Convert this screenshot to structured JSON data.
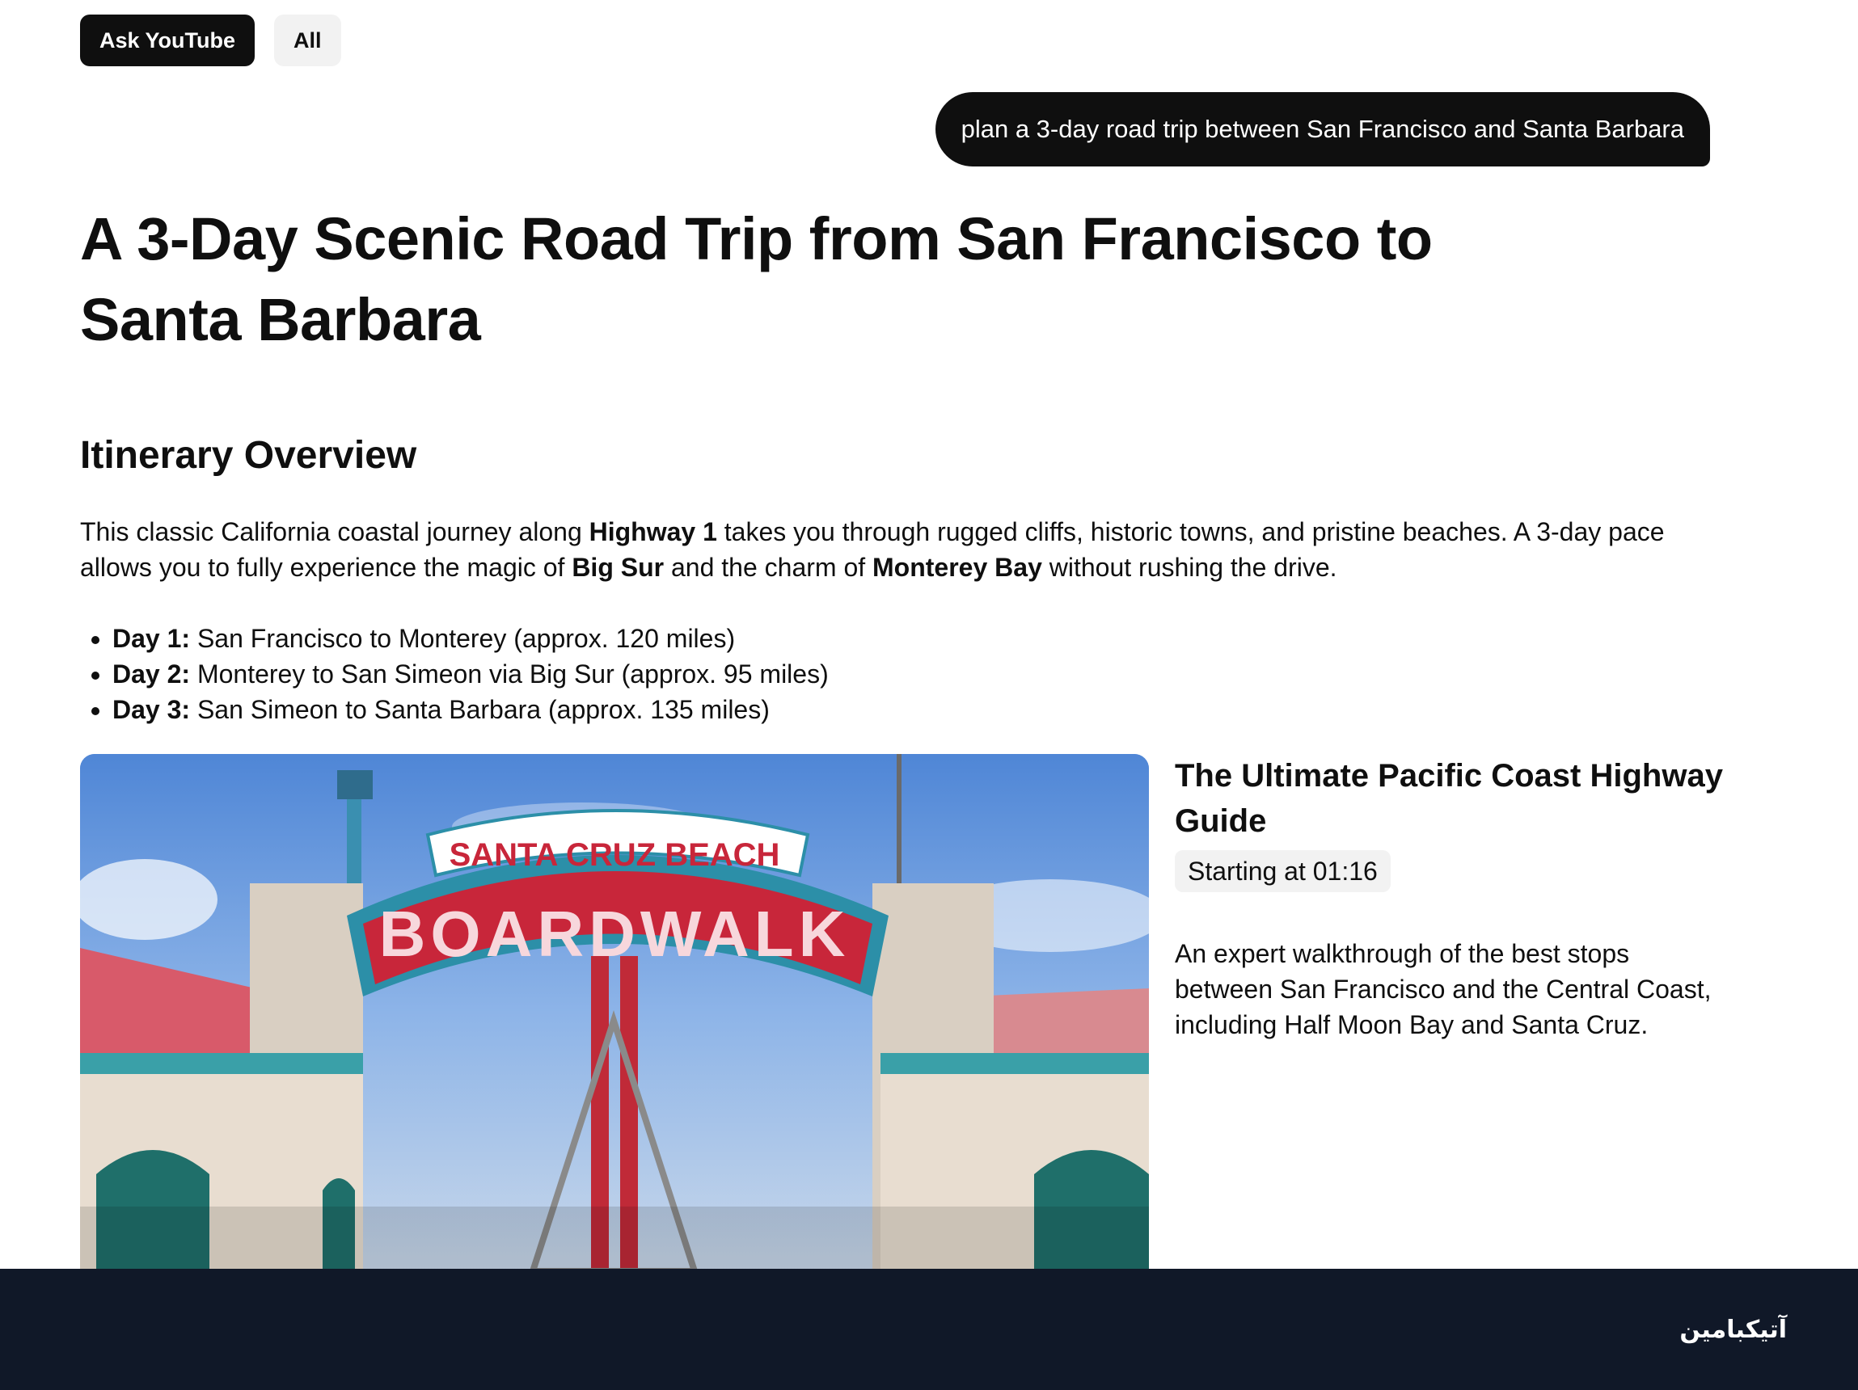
{
  "chips": [
    {
      "label": "Ask YouTube",
      "active": true
    },
    {
      "label": "All",
      "active": false
    }
  ],
  "query": "plan a 3-day road trip between San Francisco and Santa Barbara",
  "article": {
    "title": "A 3-Day Scenic Road Trip from San Francisco to Santa Barbara",
    "section_heading": "Itinerary Overview",
    "intro": {
      "p1": "This classic California coastal journey along ",
      "b1": "Highway 1",
      "p2": " takes you through rugged cliffs, historic towns, and pristine beaches. A 3-day pace allows you to fully experience the magic of ",
      "b2": "Big Sur",
      "p3": " and the charm of ",
      "b3": "Monterey Bay",
      "p4": " without rushing the drive."
    },
    "days": [
      {
        "label": "Day 1:",
        "text": " San Francisco to Monterey (approx. 120 miles)"
      },
      {
        "label": "Day 2:",
        "text": " Monterey to San Simeon via Big Sur (approx. 95 miles)"
      },
      {
        "label": "Day 3:",
        "text": " San Simeon to Santa Barbara (approx. 135 miles)"
      }
    ]
  },
  "video": {
    "sign_top": "SANTA CRUZ BEACH",
    "sign_main": "BOARDWALK",
    "title": "The Ultimate Pacific Coast Highway Guide",
    "timestamp_prefix": "Starting at ",
    "timestamp": "01:16",
    "description": "An expert walkthrough of the best stops between San Francisco and the Central Coast, including Half Moon Bay and Santa Cruz."
  },
  "footer": {
    "logo": "آتیکبامین"
  },
  "colors": {
    "text": "#0f0f0f",
    "chip_inactive": "#f2f2f2",
    "footer_bg": "#101828",
    "sign_red": "#c8263a",
    "sign_teal": "#2c8fa8"
  }
}
